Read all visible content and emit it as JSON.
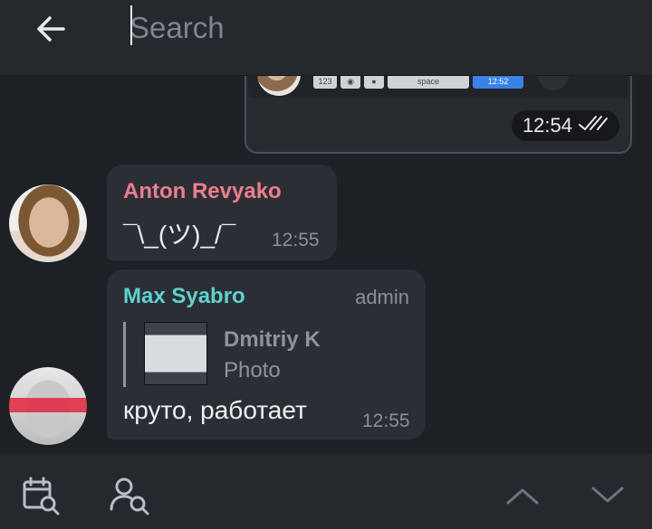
{
  "search": {
    "placeholder": "Search",
    "value": ""
  },
  "own_message": {
    "time": "12:54",
    "keyboard_keys": [
      "123",
      "space",
      "12:52"
    ]
  },
  "messages": [
    {
      "sender": "Anton Revyako",
      "text": "¯\\_(ツ)_/¯",
      "time": "12:55",
      "sender_color": "#ef7d8f"
    },
    {
      "sender": "Max Syabro",
      "role": "admin",
      "reply_to": {
        "name": "Dmitriy K",
        "type": "Photo"
      },
      "text": "круто, работает",
      "time": "12:55",
      "sender_color": "#5fd1d0"
    }
  ],
  "toolbar": {
    "icons": [
      "calendar-search-icon",
      "user-search-icon",
      "chevron-up-icon",
      "chevron-down-icon"
    ]
  },
  "colors": {
    "background": "#1d2024",
    "bar": "#25292e",
    "bubble": "#2b2f35"
  }
}
